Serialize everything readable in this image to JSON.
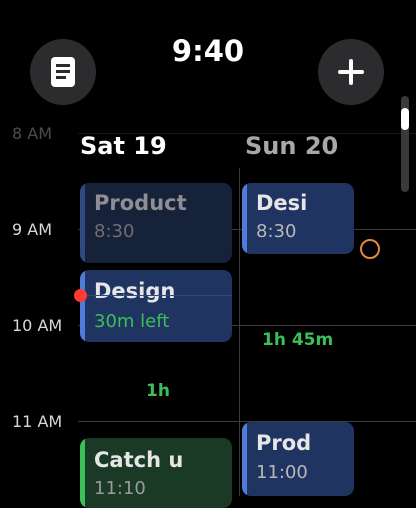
{
  "status": {
    "time": "9:40"
  },
  "toolbar": {
    "list_icon": "list-icon",
    "add_icon": "plus-icon"
  },
  "hours": [
    "8 AM",
    "9 AM",
    "10 AM",
    "11 AM"
  ],
  "days": [
    {
      "label": "Sat 19"
    },
    {
      "label": "Sun 20"
    }
  ],
  "events": {
    "sat": [
      {
        "title": "Product",
        "sub": "8:30"
      },
      {
        "title": "Design",
        "sub": "30m left"
      },
      {
        "title": "Catch u",
        "sub": "11:10"
      }
    ],
    "sun": [
      {
        "title": "Desi",
        "sub": "8:30"
      },
      {
        "title": "Prod",
        "sub": "11:00"
      }
    ]
  },
  "gaps": {
    "sat": "1h",
    "sun": "1h 45m"
  },
  "colors": {
    "blue_accent": "#4f7bd9",
    "green_accent": "#3bbf59",
    "now_dot": "#ff3b30",
    "ring": "#e08a3c"
  }
}
